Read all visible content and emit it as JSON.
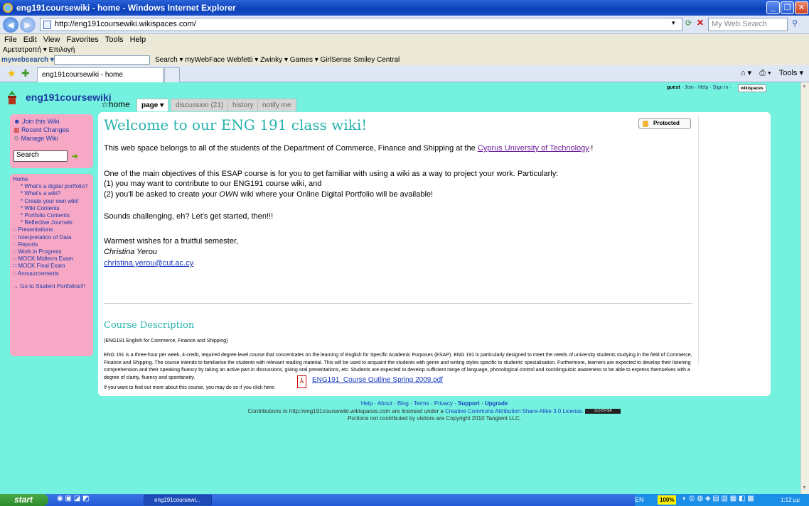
{
  "window": {
    "title": "eng191coursewiki - home - Windows Internet Explorer"
  },
  "browser": {
    "address": "http://eng191coursewiki.wikispaces.com/",
    "live_search_placeholder": "My Web Search",
    "menu": [
      "File",
      "Edit",
      "View",
      "Favorites",
      "Tools",
      "Help"
    ],
    "links_row": "Αμετατροπή ▾  Επιλογή",
    "mywebsearch_label": "mywebsearch ▾",
    "toolbar_items": "Search ▾   myWebFace   Webfetti ▾   Zwinky ▾   Games ▾   GirlSense   Smiley Central",
    "tab_title": "eng191coursewiki - home",
    "tools_label": "Tools ▾"
  },
  "wiki": {
    "name": "eng191coursewiki",
    "top_links": {
      "user": "guest",
      "links": "· Join · Help · Sign In ·",
      "badge": "wikispaces"
    },
    "home_label": "home",
    "tabs": [
      "page ▾",
      "discussion (21)",
      "history",
      "notify me"
    ],
    "sidebar_actions": [
      "Join this Wiki",
      "Recent Changes",
      "Manage Wiki"
    ],
    "search_value": "Search",
    "nav": {
      "home": "Home",
      "subs": [
        "* What's a digital portfolio?",
        "* What's a wiki?",
        "* Create your own wiki!",
        "* Wiki Contents",
        "* Portfolio Contents",
        "* Reflective Journals"
      ],
      "sections": [
        "∷ Presentations",
        "∷ Interpretation of Data",
        "∷ Reports",
        "∷ Work in Progress",
        "∷ MOCK Midterm Exam",
        "∷ MOCK Final Exam",
        "∷ Announcements"
      ],
      "portfolios": "→ Go to Student Portfolios!!!"
    }
  },
  "content": {
    "heading": "Welcome to our ENG 191 class wiki!",
    "protected": "Protected",
    "intro_before": "This web space belongs to all of the students of the Department of Commerce, Finance and Shipping at the ",
    "intro_link": "Cyprus University of Technology",
    "intro_after": "!",
    "objectives": "One of the main objectives of this ESAP course is for you to get familiar with using a wiki as a way to project your work. Particularly:",
    "point1": "(1) you may want to contribute to our ENG191 course wiki, and",
    "point2_a": "(2) you'll be asked to create your ",
    "point2_em": "OWN",
    "point2_b": " wiki where your Online Digital Portfolio will be available!",
    "challenge": "Sounds challenging, eh? Let's get started, then!!!",
    "wishes": "Warmest wishes for a fruitful semester,",
    "author": "Christina Yerou",
    "email": "christina.yerou@cut.ac.cy",
    "course_heading": "Course Description",
    "course_sub": "(ENG191 English for Commerce, Finance and Shipping)",
    "course_body": "ENG 191 is a three-hour per week, 4-credit, required degree level course that concentrates on the learning of English for Specific Academic Purposes (ESAP). ENG 191 is particularly designed to meet the needs of university students studying in the field of Commerce, Finance and Shipping. The course intends to familiarise the students with relevant reading material. This will be used to acquaint the students with genre and writing styles specific to students' specialisation. Furthermore, learners are expected to develop their listening comprehension and their speaking fluency by taking an active part in discussions, giving oral presentations, etc. Students are expected to develop sufficient range of language, phonological control and sociolinguistic awareness to be able to express themselves with a degree of clarity, fluency and spontaneity.",
    "find_out": "If you want to find out more about this course, you may do so if you click here:",
    "pdf_link": "ENG191_Course Outline Spring 2009.pdf"
  },
  "footer": {
    "links": "Help · About · Blog · Terms · Privacy ·",
    "support": "Support",
    "upgrade": "Upgrade",
    "license_text": "Contributions to http://eng191coursewiki.wikispaces.com are licensed under a ",
    "license_link": "Creative Commons Attribution Share-Alike 3.0 License.",
    "copyright": "Portions not contributed by visitors are Copyright 2010 Tangient LLC."
  },
  "taskbar": {
    "start": "start",
    "task": "eng191coursewi...",
    "lang": "EN",
    "zoom": "100%",
    "clock": "1:12 μμ"
  },
  "colors": {
    "page_bg": "#74f2df",
    "sidebar_bg": "#f7a8c4",
    "heading": "#27b3ad"
  }
}
